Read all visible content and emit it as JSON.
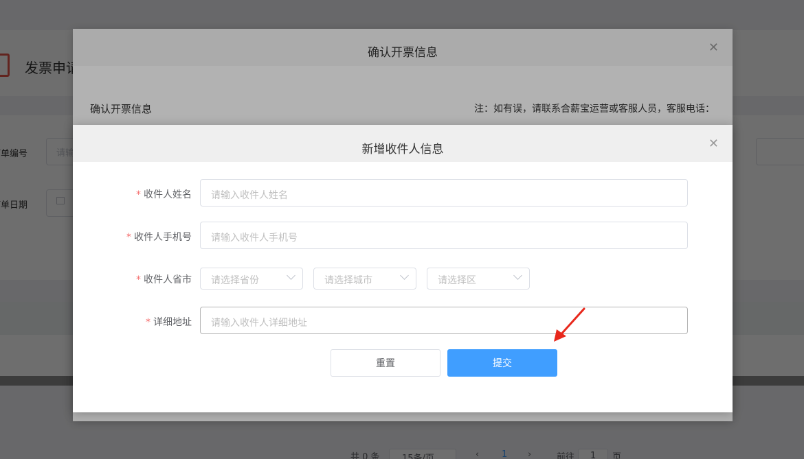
{
  "background": {
    "page_title": "发票申请",
    "field_order_no_label": "订单编号",
    "field_order_no_placeholder": "请输",
    "field_order_date_label": "订单日期",
    "pager": {
      "total": "共 0 条",
      "page_size": "15条/页",
      "current_page": "1",
      "goto_label": "前往",
      "goto_value": "1",
      "page_unit": "页"
    }
  },
  "dialog_confirm": {
    "title": "确认开票信息",
    "section_title": "确认开票信息",
    "note": "注：如有误，请联系合薪宝运营或客服人员，客服电话："
  },
  "dialog_new_recipient": {
    "title": "新增收件人信息",
    "fields": {
      "name": {
        "label": "收件人姓名",
        "placeholder": "请输入收件人姓名"
      },
      "phone": {
        "label": "收件人手机号",
        "placeholder": "请输入收件人手机号"
      },
      "region": {
        "label": "收件人省市",
        "province_placeholder": "请选择省份",
        "city_placeholder": "请选择城市",
        "district_placeholder": "请选择区"
      },
      "address": {
        "label": "详细地址",
        "placeholder": "请输入收件人详细地址"
      }
    },
    "required_mark": "*",
    "reset_label": "重置",
    "submit_label": "提交"
  },
  "colors": {
    "primary": "#409eff",
    "required": "#f56c6c",
    "arrow": "#e8281c"
  }
}
